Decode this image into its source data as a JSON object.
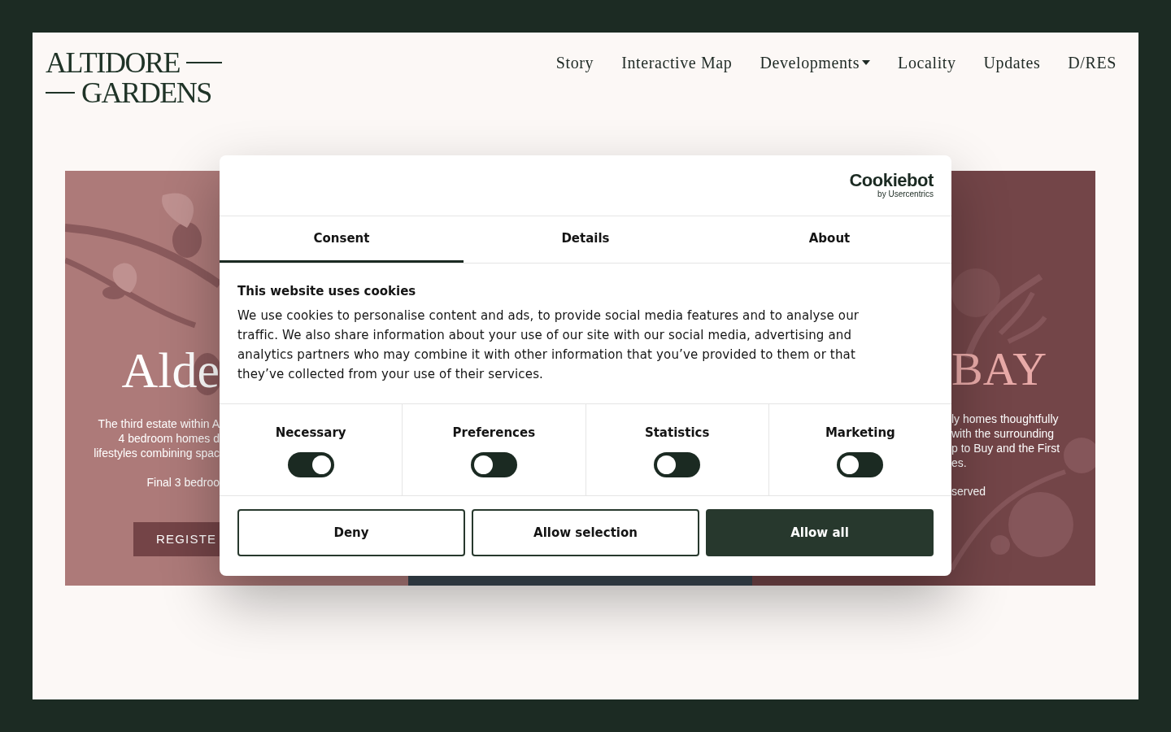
{
  "logo": {
    "line_1": "ALTIDORE",
    "line_2": "GARDENS"
  },
  "nav": [
    {
      "label": "Story",
      "dropdown": false
    },
    {
      "label": "Interactive Map",
      "dropdown": false
    },
    {
      "label": "Developments",
      "dropdown": true
    },
    {
      "label": "Locality",
      "dropdown": false
    },
    {
      "label": "Updates",
      "dropdown": false
    },
    {
      "label": "D/RES",
      "dropdown": false
    }
  ],
  "panels": [
    {
      "kind": "left",
      "title": "Alde",
      "lines": [
        "The third estate within A",
        "4 bedroom homes d",
        "lifestyles combining spac"
      ],
      "note": "Final 3 bedroo",
      "button": "REGISTE"
    },
    {
      "kind": "middle"
    },
    {
      "kind": "right",
      "title": "BAY",
      "lines": [
        "ly homes thoughtfully",
        "with the surrounding",
        "p to Buy and the First",
        "es."
      ],
      "note": "served"
    }
  ],
  "dialog": {
    "brand": "Cookiebot",
    "brand_sub": "by Usercentrics",
    "tabs": [
      {
        "label": "Consent",
        "selected": true
      },
      {
        "label": "Details",
        "selected": false
      },
      {
        "label": "About",
        "selected": false
      }
    ],
    "heading": "This website uses cookies",
    "body": "We use cookies to personalise content and ads, to provide social media features and to analyse our traffic. We also share information about your use of our site with our social media, advertising and analytics partners who may combine it with other information that you’ve provided to them or that they’ve collected from your use of their services.",
    "toggles": [
      {
        "label": "Necessary",
        "on": true
      },
      {
        "label": "Preferences",
        "on": false
      },
      {
        "label": "Statistics",
        "on": false
      },
      {
        "label": "Marketing",
        "on": false
      }
    ],
    "buttons": [
      {
        "label": "Deny",
        "kind": "outline"
      },
      {
        "label": "Allow selection",
        "kind": "outline"
      },
      {
        "label": "Allow all",
        "kind": "primary"
      }
    ]
  }
}
